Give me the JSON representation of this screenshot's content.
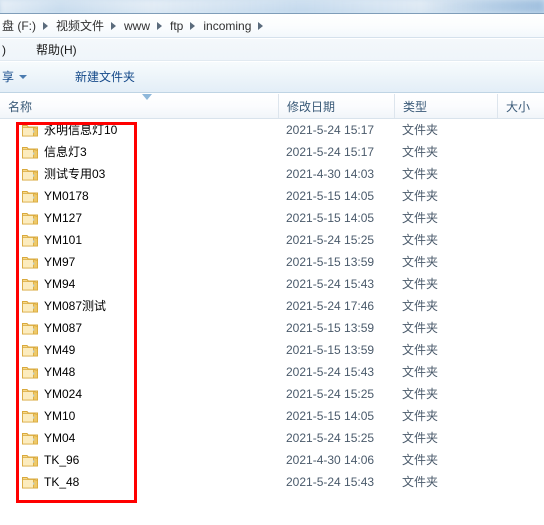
{
  "window": {
    "chrome_label": "window-title-bar"
  },
  "address_bar": {
    "crumbs": [
      {
        "label": "盘 (F:)",
        "truncated": true
      },
      {
        "label": "视频文件",
        "truncated": false
      },
      {
        "label": "www",
        "truncated": false
      },
      {
        "label": "ftp",
        "truncated": false
      },
      {
        "label": "incoming",
        "truncated": false
      }
    ]
  },
  "menu_bar": {
    "items": [
      {
        "label": ")",
        "truncated": true
      },
      {
        "label": "帮助(H)",
        "truncated": false
      }
    ]
  },
  "toolbar": {
    "share_label": "享",
    "new_folder_label": "新建文件夹"
  },
  "columns": {
    "name": "名称",
    "date_modified": "修改日期",
    "type": "类型",
    "size": "大小",
    "sort_column": "名称",
    "sort_direction": "descending"
  },
  "colors": {
    "annotation": "#ff0000",
    "header_text": "#3a5a78",
    "row_text": "#000000",
    "secondary_text": "#4a5a6b",
    "toolbar_text": "#154a8a",
    "folder_body": "#f7d98b",
    "folder_edge": "#d9a93c"
  },
  "files": [
    {
      "name": "永明信息灯10",
      "date": "2021-5-24 15:17",
      "type": "文件夹",
      "size": ""
    },
    {
      "name": "信息灯3",
      "date": "2021-5-24 15:17",
      "type": "文件夹",
      "size": ""
    },
    {
      "name": "测试专用03",
      "date": "2021-4-30 14:03",
      "type": "文件夹",
      "size": ""
    },
    {
      "name": "YM0178",
      "date": "2021-5-15 14:05",
      "type": "文件夹",
      "size": ""
    },
    {
      "name": "YM127",
      "date": "2021-5-15 14:05",
      "type": "文件夹",
      "size": ""
    },
    {
      "name": "YM101",
      "date": "2021-5-24 15:25",
      "type": "文件夹",
      "size": ""
    },
    {
      "name": "YM97",
      "date": "2021-5-15 13:59",
      "type": "文件夹",
      "size": ""
    },
    {
      "name": "YM94",
      "date": "2021-5-24 15:43",
      "type": "文件夹",
      "size": ""
    },
    {
      "name": "YM087测试",
      "date": "2021-5-24 17:46",
      "type": "文件夹",
      "size": ""
    },
    {
      "name": "YM087",
      "date": "2021-5-15 13:59",
      "type": "文件夹",
      "size": ""
    },
    {
      "name": "YM49",
      "date": "2021-5-15 13:59",
      "type": "文件夹",
      "size": ""
    },
    {
      "name": "YM48",
      "date": "2021-5-24 15:43",
      "type": "文件夹",
      "size": ""
    },
    {
      "name": "YM024",
      "date": "2021-5-24 15:25",
      "type": "文件夹",
      "size": ""
    },
    {
      "name": "YM10",
      "date": "2021-5-15 14:05",
      "type": "文件夹",
      "size": ""
    },
    {
      "name": "YM04",
      "date": "2021-5-24 15:25",
      "type": "文件夹",
      "size": ""
    },
    {
      "name": "TK_96",
      "date": "2021-4-30 14:06",
      "type": "文件夹",
      "size": ""
    },
    {
      "name": "TK_48",
      "date": "2021-5-24 15:43",
      "type": "文件夹",
      "size": ""
    }
  ]
}
